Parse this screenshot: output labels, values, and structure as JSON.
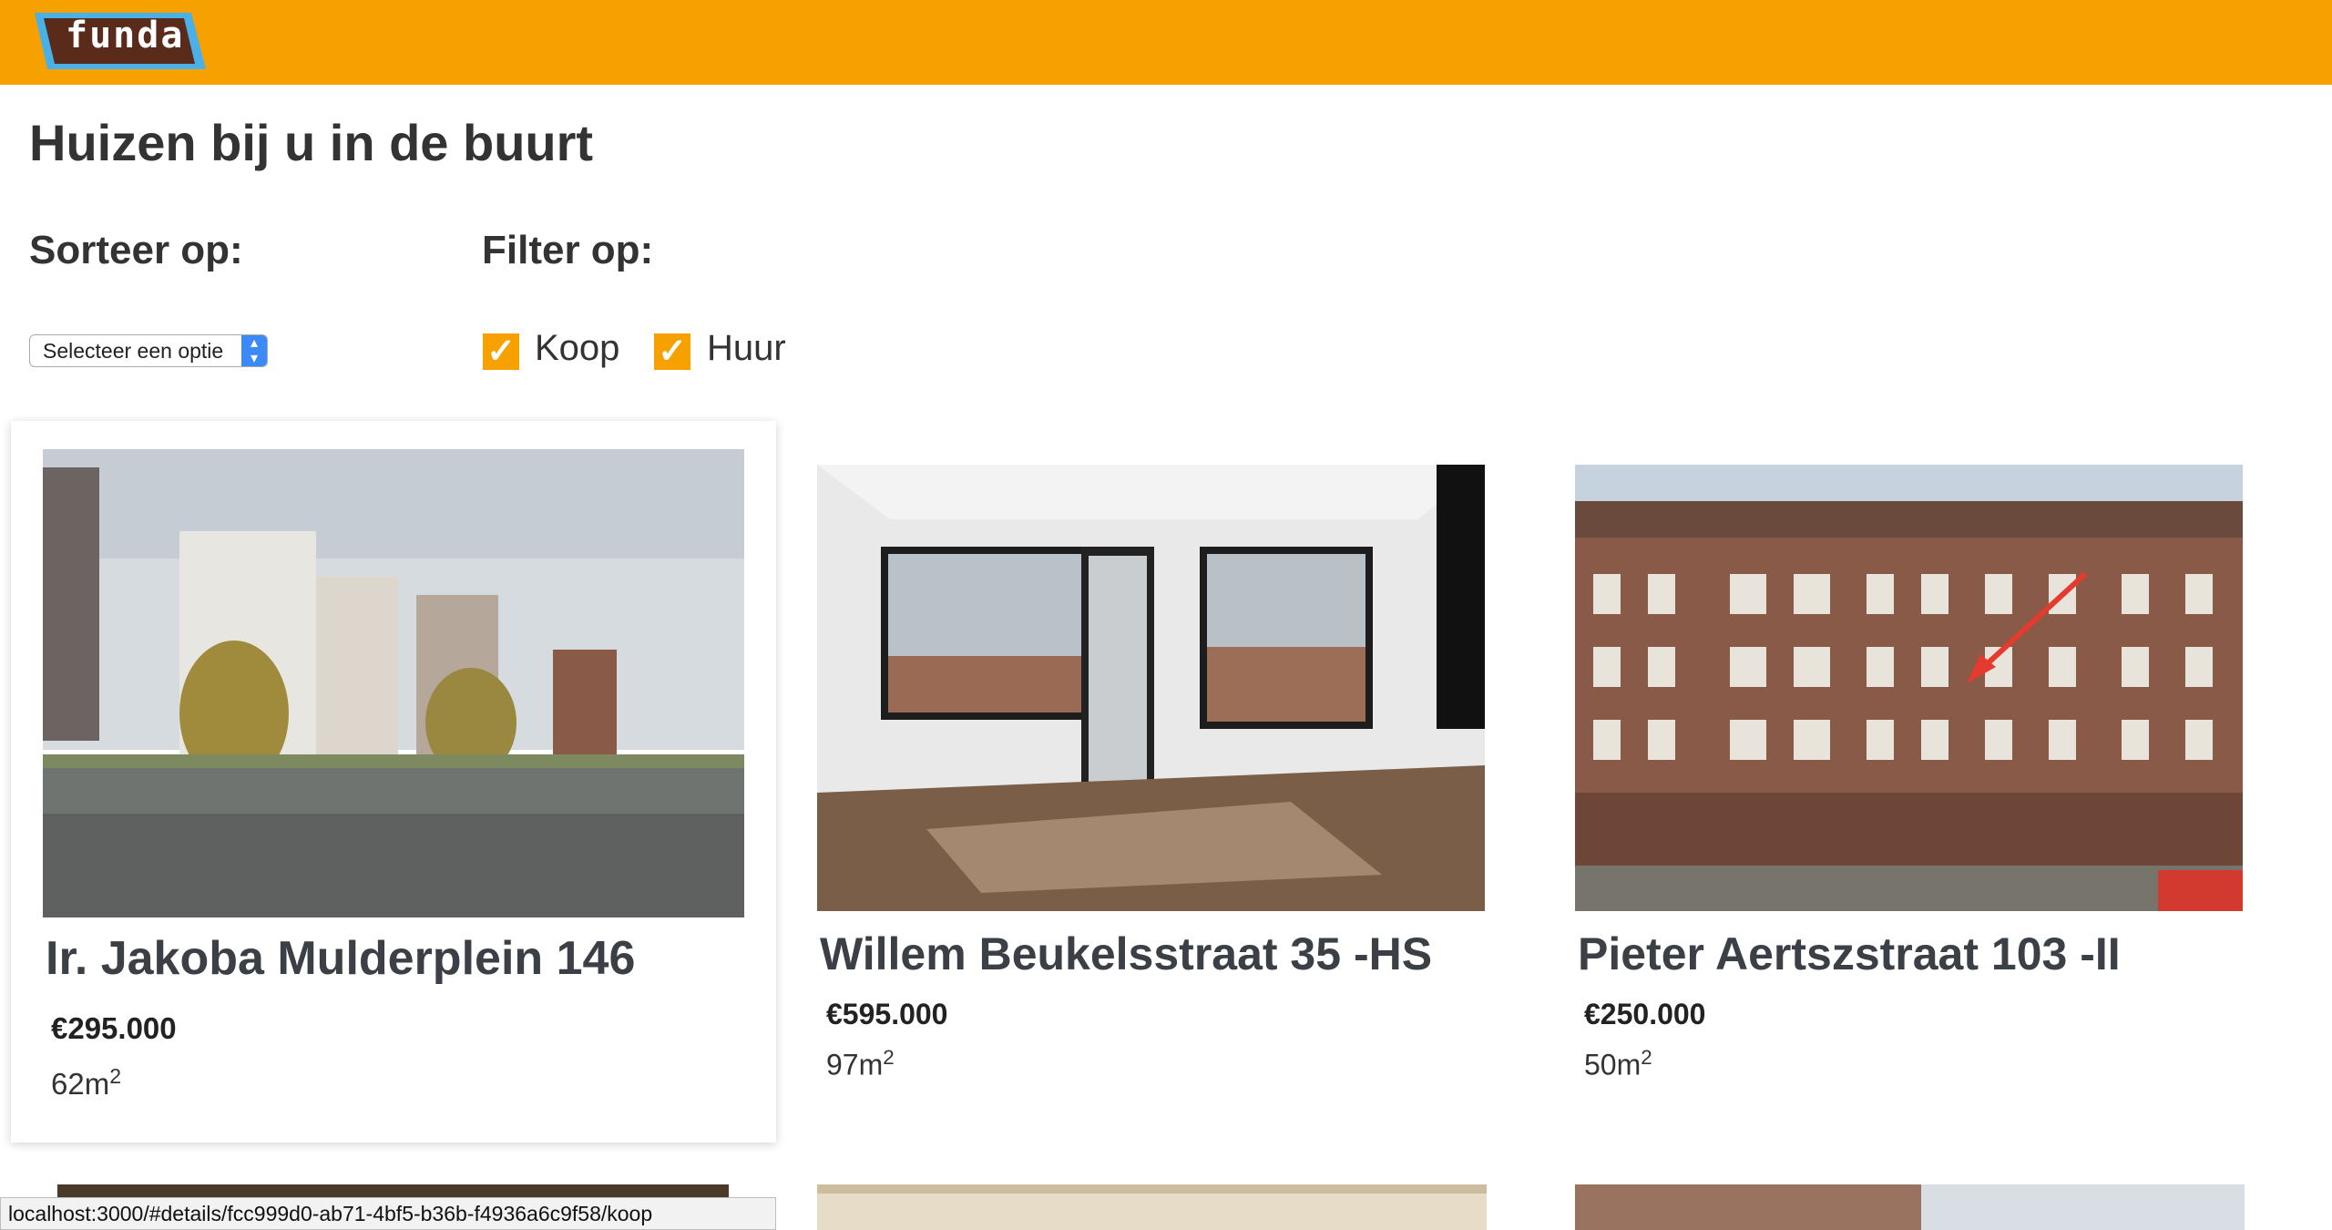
{
  "header": {
    "logo_text": "funda"
  },
  "page": {
    "title": "Huizen bij u in de buurt"
  },
  "sort": {
    "label": "Sorteer op:",
    "selected": "Selecteer een optie"
  },
  "filter": {
    "label": "Filter op:",
    "options": [
      {
        "label": "Koop",
        "checked": true
      },
      {
        "label": "Huur",
        "checked": true
      }
    ]
  },
  "listings": [
    {
      "address": "Ir. Jakoba Mulderplein 146",
      "price": "€295.000",
      "area": "62m",
      "area_unit": "2"
    },
    {
      "address": "Willem Beukelsstraat 35 -HS",
      "price": "€595.000",
      "area": "97m",
      "area_unit": "2"
    },
    {
      "address": "Pieter Aertszstraat 103 -II",
      "price": "€250.000",
      "area": "50m",
      "area_unit": "2"
    }
  ],
  "status_bar": {
    "url": "localhost:3000/#details/fcc999d0-ab71-4bf5-b36b-f4936a6c9f58/koop"
  },
  "colors": {
    "brand": "#f7a100",
    "logo_blue": "#4ab0e8",
    "logo_dark": "#5a2a1a"
  }
}
